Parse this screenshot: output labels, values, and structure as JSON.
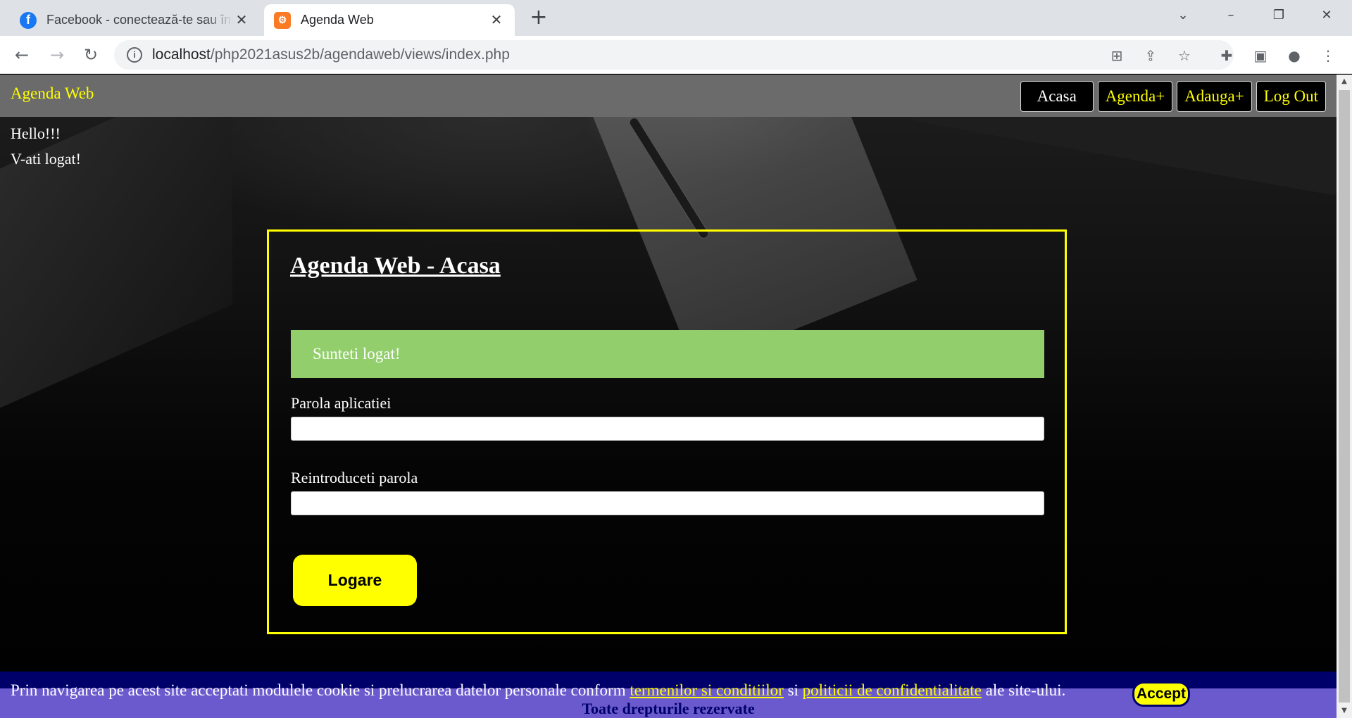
{
  "browser": {
    "tabs": [
      {
        "title": "Facebook - conectează-te sau înscrie-te",
        "icon": "facebook-icon"
      },
      {
        "title": "Agenda Web",
        "icon": "xampp-icon"
      }
    ],
    "url_host": "localhost",
    "url_path": "/php2021asus2b/agendaweb/views/index.php"
  },
  "navbar": {
    "brand": "Agenda Web",
    "buttons": [
      "Acasa",
      "Agenda+",
      "Adauga+",
      "Log Out"
    ]
  },
  "greeting": {
    "line1": "Hello!!!",
    "line2": "V-ati logat!"
  },
  "card": {
    "title": "Agenda Web - Acasa",
    "alert": "Sunteti logat!",
    "password_label": "Parola aplicatiei",
    "password_value": "",
    "confirm_label": "Reintroduceti parola",
    "confirm_value": "",
    "submit_label": "Logare"
  },
  "cookie": {
    "text_before": "Prin navigarea pe acest site acceptati modulele cookie si prelucrarea datelor personale conform ",
    "link_terms": "termenilor si conditiilor",
    "text_middle": " si ",
    "link_privacy": "politicii de confidentialitate",
    "text_after": " ale site-ului.",
    "accept_label": "Accept",
    "footer": "Toate drepturile rezervate"
  },
  "colors": {
    "accent": "#ffff00",
    "navbar": "#6b6b6b",
    "alert": "#92cf6c",
    "cookie_bar": "#6a5acd",
    "cookie_text_dark": "#00006a"
  }
}
